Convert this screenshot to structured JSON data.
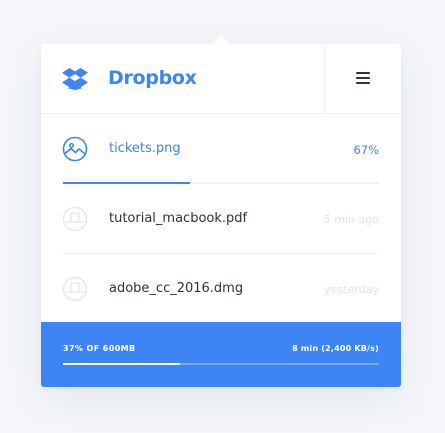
{
  "header": {
    "brand": "Dropbox",
    "logo_icon": "dropbox-logo-icon",
    "menu_icon": "hamburger-menu-icon"
  },
  "files": [
    {
      "name": "tickets.png",
      "meta": "67%",
      "progress": 0.67,
      "status": "uploading",
      "icon": "image-file-icon"
    },
    {
      "name": "tutorial_macbook.pdf",
      "meta": "5 min ago",
      "status": "done",
      "icon": "document-file-icon"
    },
    {
      "name": "adobe_cc_2016.dmg",
      "meta": "yesterday",
      "status": "done",
      "icon": "document-file-icon"
    }
  ],
  "footer": {
    "storage_label": "37% OF 600MB",
    "storage_fraction": 0.37,
    "transfer_label": "8 min (2,400 KB/s)"
  },
  "colors": {
    "accent": "#3d84f5",
    "text": "#2b3340",
    "muted": "#dfe3e9",
    "background": "#f4f6f9"
  }
}
